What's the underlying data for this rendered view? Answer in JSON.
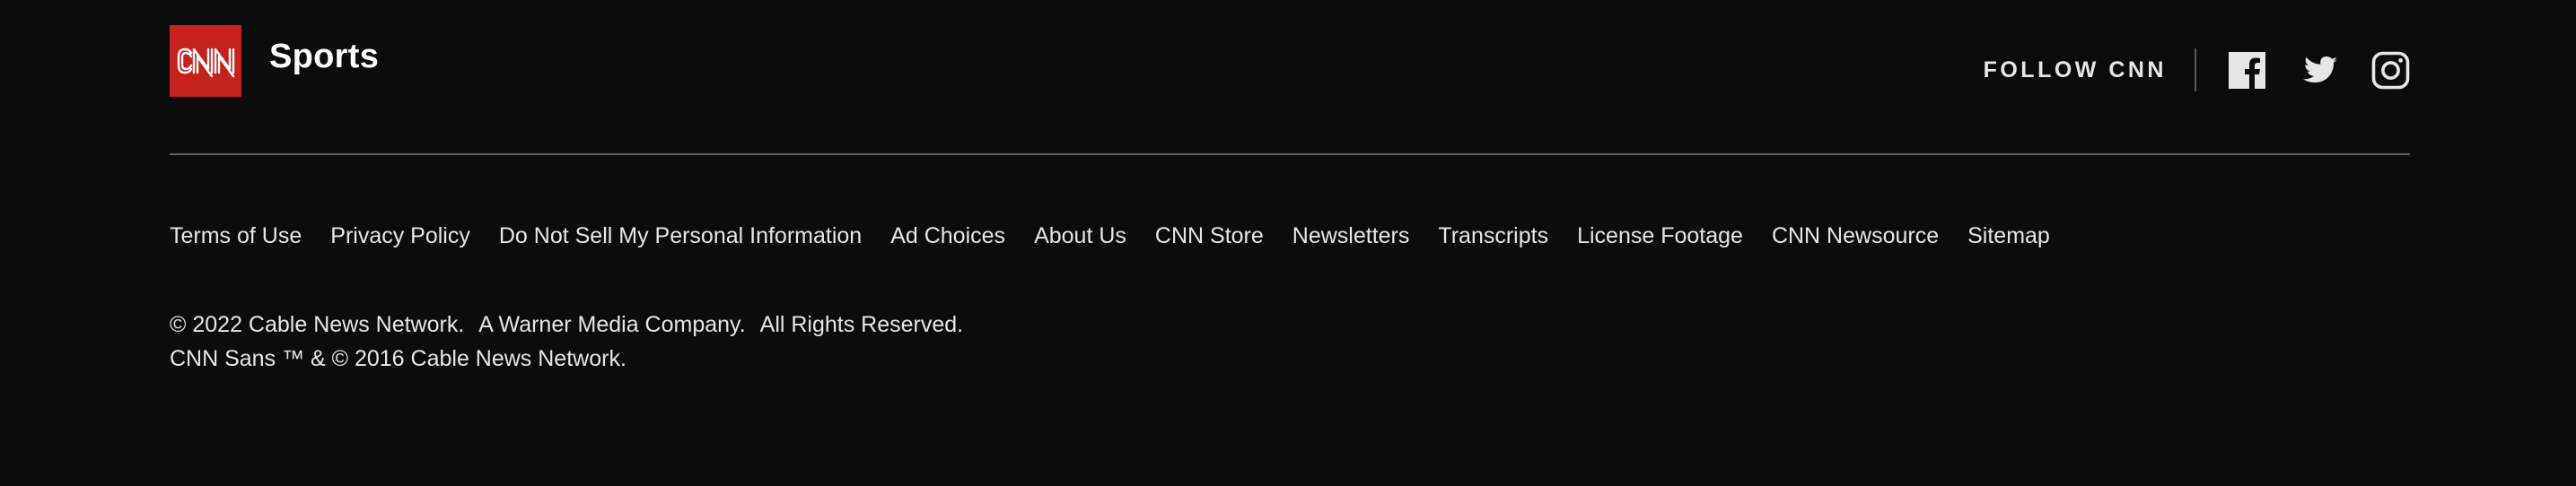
{
  "brand": {
    "logo_text": "CNN",
    "section": "Sports",
    "logo_color": "#c4221a"
  },
  "follow": {
    "label": "FOLLOW CNN",
    "icons": [
      "facebook-icon",
      "twitter-icon",
      "instagram-icon"
    ]
  },
  "links": [
    "Terms of Use",
    "Privacy Policy",
    "Do Not Sell My Personal Information",
    "Ad Choices",
    "About Us",
    "CNN Store",
    "Newsletters",
    "Transcripts",
    "License Footage",
    "CNN Newsource",
    "Sitemap"
  ],
  "legal": {
    "copyright": "© 2022 Cable News Network.",
    "company": "A Warner Media Company.",
    "rights": "All Rights Reserved.",
    "font_notice": "CNN Sans ™ & © 2016 Cable News Network."
  },
  "colors": {
    "background": "#0c0c0c",
    "text": "#e6e6e6",
    "divider": "#5e5e5e"
  }
}
